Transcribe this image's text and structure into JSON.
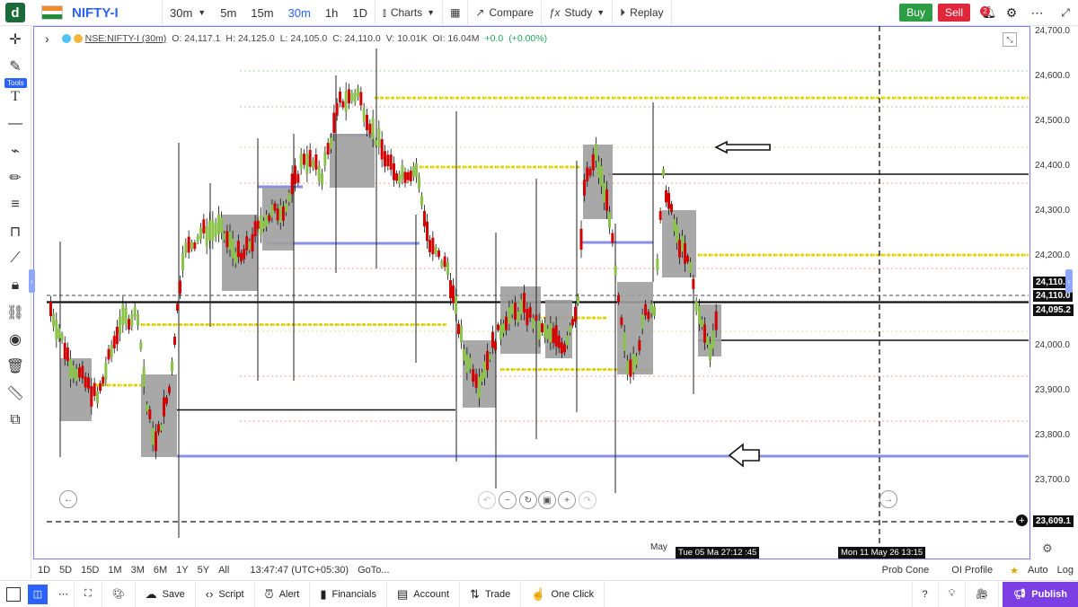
{
  "app": {
    "logo_letter": "d",
    "symbol": "NIFTY-I"
  },
  "toolbar": {
    "interval": "30m",
    "intervals": [
      "5m",
      "15m",
      "30m",
      "1h",
      "1D"
    ],
    "active_interval": "30m",
    "charts_label": "Charts",
    "compare_label": "Compare",
    "study_label": "Study",
    "replay_label": "Replay",
    "buy_label": "Buy",
    "sell_label": "Sell",
    "notif_count": "2"
  },
  "leftbar": {
    "tools_label": "Tools"
  },
  "legend": {
    "source": "NSE:NIFTY-I (30m)",
    "o": "O: 24,117.1",
    "h": "H: 24,125.0",
    "l": "L: 24,105.0",
    "c": "C: 24,110.0",
    "v": "V: 10.01K",
    "oi": "OI: 16.04M",
    "chg": "+0.0",
    "chg_pct": "(+0.00%)"
  },
  "axis": {
    "y_ticks": [
      "24,700.0",
      "24,600.0",
      "24,500.0",
      "24,400.0",
      "24,300.0",
      "24,200.0",
      "24,000.0",
      "23,900.0",
      "23,800.0",
      "23,700.0"
    ],
    "price_tags": [
      "24,110.",
      "24,110.0",
      "24,095.2",
      "23,609.1"
    ],
    "x_month": "May",
    "cursor_left": "Tue 05 Ma 27:12 :45",
    "cursor_right": "Mon 11 May 26 13:15"
  },
  "bottom_bar": {
    "ranges": [
      "1D",
      "5D",
      "15D",
      "1M",
      "3M",
      "6M",
      "1Y",
      "5Y",
      "All"
    ],
    "time": "13:47:47 (UTC+05:30)",
    "goto": "GoTo...",
    "prob_cone": "Prob Cone",
    "oi_profile": "OI Profile",
    "auto": "Auto",
    "log": "Log"
  },
  "footer": {
    "save": "Save",
    "script": "Script",
    "alert": "Alert",
    "financials": "Financials",
    "account": "Account",
    "trade": "Trade",
    "one_click": "One Click",
    "publish": "Publish"
  },
  "colors": {
    "up": "#8bc34a",
    "down": "#d50000",
    "accent": "#2962ff",
    "publish": "#7b3fe4",
    "level_yellow": "#f0e000",
    "level_blue": "#8a8fe8"
  }
}
